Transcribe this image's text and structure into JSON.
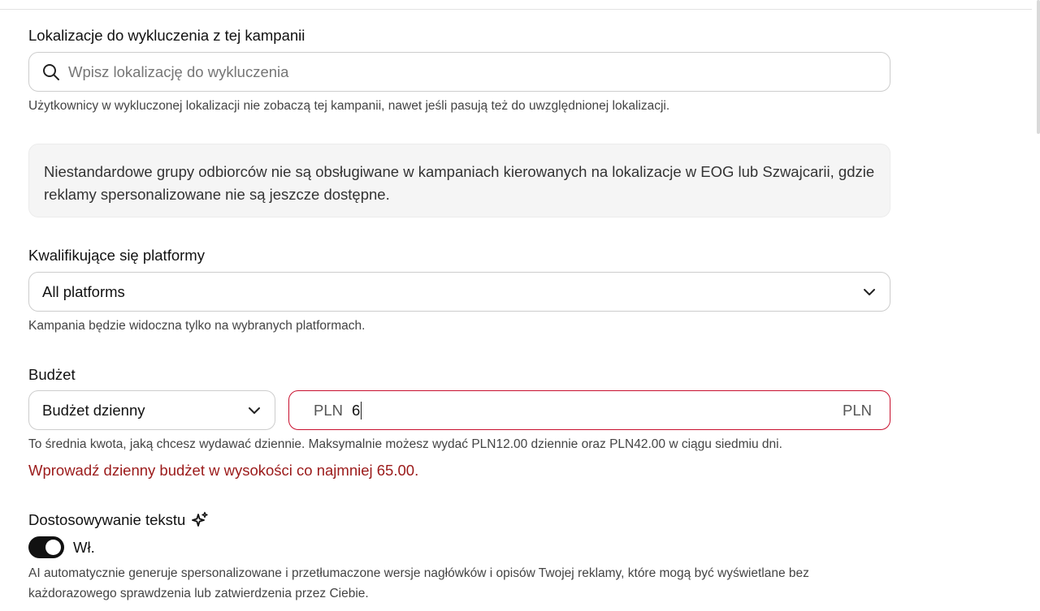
{
  "exclusions": {
    "label": "Lokalizacje do wykluczenia z tej kampanii",
    "placeholder": "Wpisz lokalizację do wykluczenia",
    "helper": "Użytkownicy w wykluczonej lokalizacji nie zobaczą tej kampanii, nawet jeśli pasują też do uwzględnionej lokalizacji."
  },
  "notice": {
    "text": "Niestandardowe grupy odbiorców nie są obsługiwane w kampaniach kierowanych na lokalizacje w EOG lub Szwajcarii, gdzie reklamy spersonalizowane nie są jeszcze dostępne."
  },
  "platforms": {
    "label": "Kwalifikujące się platformy",
    "value": "All platforms",
    "helper": "Kampania będzie widoczna tylko na wybranych platformach."
  },
  "budget": {
    "label": "Budżet",
    "type_value": "Budżet dzienny",
    "prefix": "PLN",
    "amount": "6",
    "suffix": "PLN",
    "helper": "To średnia kwota, jaką chcesz wydawać dziennie. Maksymalnie możesz wydać PLN12.00 dziennie oraz PLN42.00 w ciągu siedmiu dni.",
    "error": "Wprowadź dzienny budżet w wysokości co najmniej 65.00.",
    "error_color": "#9b1a1a"
  },
  "text_customization": {
    "label": "Dostosowywanie tekstu",
    "icon": "sparkle-icon",
    "toggle_on": true,
    "toggle_label": "Wł.",
    "description": "AI automatycznie generuje spersonalizowane i przetłumaczone wersje nagłówków i opisów Twojej reklamy, które mogą być wyświetlane bez każdorazowego sprawdzenia lub zatwierdzenia przez Ciebie."
  }
}
